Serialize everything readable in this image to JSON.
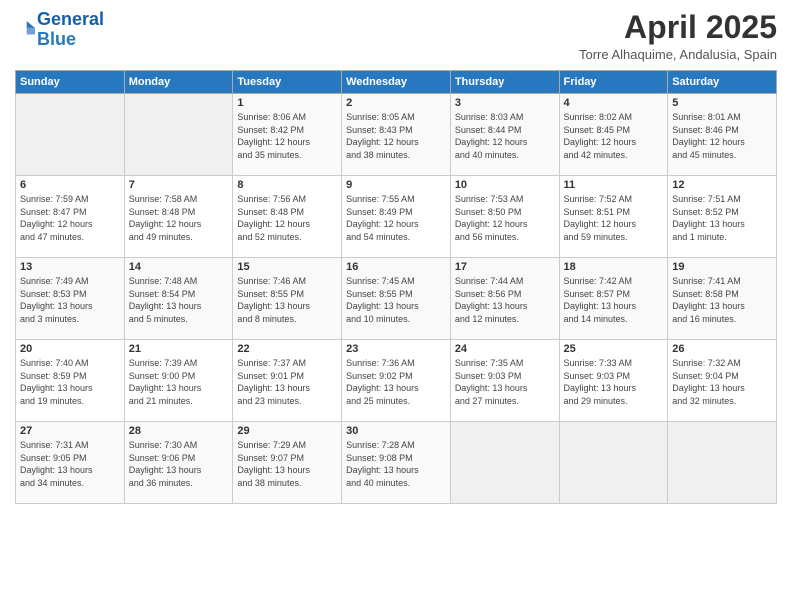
{
  "header": {
    "logo_line1": "General",
    "logo_line2": "Blue",
    "title": "April 2025",
    "location": "Torre Alhaquime, Andalusia, Spain"
  },
  "weekdays": [
    "Sunday",
    "Monday",
    "Tuesday",
    "Wednesday",
    "Thursday",
    "Friday",
    "Saturday"
  ],
  "weeks": [
    [
      {
        "day": "",
        "info": ""
      },
      {
        "day": "",
        "info": ""
      },
      {
        "day": "1",
        "info": "Sunrise: 8:06 AM\nSunset: 8:42 PM\nDaylight: 12 hours\nand 35 minutes."
      },
      {
        "day": "2",
        "info": "Sunrise: 8:05 AM\nSunset: 8:43 PM\nDaylight: 12 hours\nand 38 minutes."
      },
      {
        "day": "3",
        "info": "Sunrise: 8:03 AM\nSunset: 8:44 PM\nDaylight: 12 hours\nand 40 minutes."
      },
      {
        "day": "4",
        "info": "Sunrise: 8:02 AM\nSunset: 8:45 PM\nDaylight: 12 hours\nand 42 minutes."
      },
      {
        "day": "5",
        "info": "Sunrise: 8:01 AM\nSunset: 8:46 PM\nDaylight: 12 hours\nand 45 minutes."
      }
    ],
    [
      {
        "day": "6",
        "info": "Sunrise: 7:59 AM\nSunset: 8:47 PM\nDaylight: 12 hours\nand 47 minutes."
      },
      {
        "day": "7",
        "info": "Sunrise: 7:58 AM\nSunset: 8:48 PM\nDaylight: 12 hours\nand 49 minutes."
      },
      {
        "day": "8",
        "info": "Sunrise: 7:56 AM\nSunset: 8:48 PM\nDaylight: 12 hours\nand 52 minutes."
      },
      {
        "day": "9",
        "info": "Sunrise: 7:55 AM\nSunset: 8:49 PM\nDaylight: 12 hours\nand 54 minutes."
      },
      {
        "day": "10",
        "info": "Sunrise: 7:53 AM\nSunset: 8:50 PM\nDaylight: 12 hours\nand 56 minutes."
      },
      {
        "day": "11",
        "info": "Sunrise: 7:52 AM\nSunset: 8:51 PM\nDaylight: 12 hours\nand 59 minutes."
      },
      {
        "day": "12",
        "info": "Sunrise: 7:51 AM\nSunset: 8:52 PM\nDaylight: 13 hours\nand 1 minute."
      }
    ],
    [
      {
        "day": "13",
        "info": "Sunrise: 7:49 AM\nSunset: 8:53 PM\nDaylight: 13 hours\nand 3 minutes."
      },
      {
        "day": "14",
        "info": "Sunrise: 7:48 AM\nSunset: 8:54 PM\nDaylight: 13 hours\nand 5 minutes."
      },
      {
        "day": "15",
        "info": "Sunrise: 7:46 AM\nSunset: 8:55 PM\nDaylight: 13 hours\nand 8 minutes."
      },
      {
        "day": "16",
        "info": "Sunrise: 7:45 AM\nSunset: 8:55 PM\nDaylight: 13 hours\nand 10 minutes."
      },
      {
        "day": "17",
        "info": "Sunrise: 7:44 AM\nSunset: 8:56 PM\nDaylight: 13 hours\nand 12 minutes."
      },
      {
        "day": "18",
        "info": "Sunrise: 7:42 AM\nSunset: 8:57 PM\nDaylight: 13 hours\nand 14 minutes."
      },
      {
        "day": "19",
        "info": "Sunrise: 7:41 AM\nSunset: 8:58 PM\nDaylight: 13 hours\nand 16 minutes."
      }
    ],
    [
      {
        "day": "20",
        "info": "Sunrise: 7:40 AM\nSunset: 8:59 PM\nDaylight: 13 hours\nand 19 minutes."
      },
      {
        "day": "21",
        "info": "Sunrise: 7:39 AM\nSunset: 9:00 PM\nDaylight: 13 hours\nand 21 minutes."
      },
      {
        "day": "22",
        "info": "Sunrise: 7:37 AM\nSunset: 9:01 PM\nDaylight: 13 hours\nand 23 minutes."
      },
      {
        "day": "23",
        "info": "Sunrise: 7:36 AM\nSunset: 9:02 PM\nDaylight: 13 hours\nand 25 minutes."
      },
      {
        "day": "24",
        "info": "Sunrise: 7:35 AM\nSunset: 9:03 PM\nDaylight: 13 hours\nand 27 minutes."
      },
      {
        "day": "25",
        "info": "Sunrise: 7:33 AM\nSunset: 9:03 PM\nDaylight: 13 hours\nand 29 minutes."
      },
      {
        "day": "26",
        "info": "Sunrise: 7:32 AM\nSunset: 9:04 PM\nDaylight: 13 hours\nand 32 minutes."
      }
    ],
    [
      {
        "day": "27",
        "info": "Sunrise: 7:31 AM\nSunset: 9:05 PM\nDaylight: 13 hours\nand 34 minutes."
      },
      {
        "day": "28",
        "info": "Sunrise: 7:30 AM\nSunset: 9:06 PM\nDaylight: 13 hours\nand 36 minutes."
      },
      {
        "day": "29",
        "info": "Sunrise: 7:29 AM\nSunset: 9:07 PM\nDaylight: 13 hours\nand 38 minutes."
      },
      {
        "day": "30",
        "info": "Sunrise: 7:28 AM\nSunset: 9:08 PM\nDaylight: 13 hours\nand 40 minutes."
      },
      {
        "day": "",
        "info": ""
      },
      {
        "day": "",
        "info": ""
      },
      {
        "day": "",
        "info": ""
      }
    ]
  ]
}
